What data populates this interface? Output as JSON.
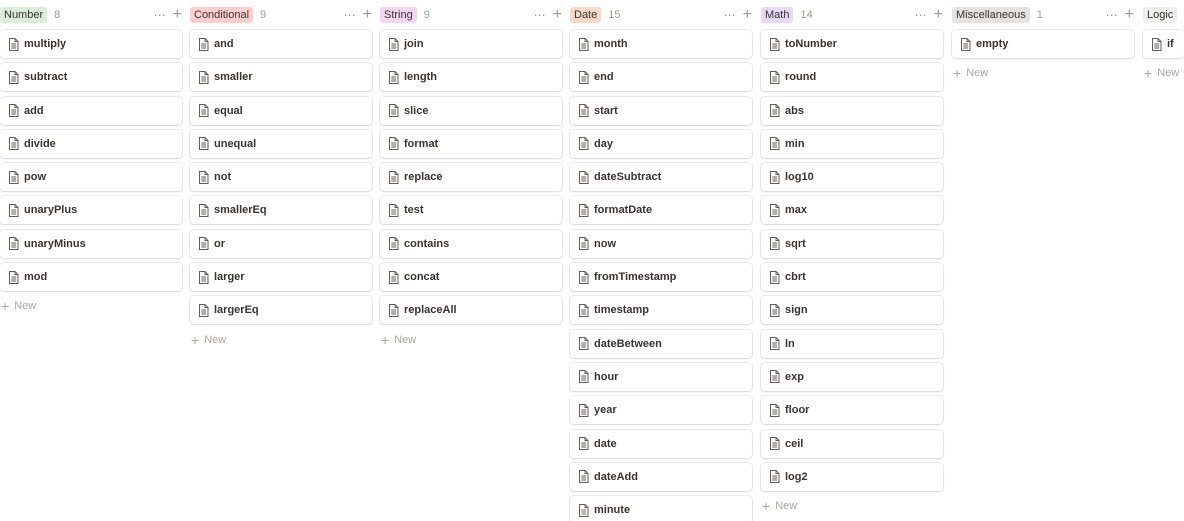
{
  "board": {
    "new_label": "New",
    "columns": [
      {
        "title": "Number",
        "count": "8",
        "tag_color": "#dbeddb",
        "items": [
          "multiply",
          "subtract",
          "add",
          "divide",
          "pow",
          "unaryPlus",
          "unaryMinus",
          "mod"
        ],
        "new_label": "New"
      },
      {
        "title": "Conditional",
        "count": "9",
        "tag_color": "#ffcfcf",
        "items": [
          "and",
          "smaller",
          "equal",
          "unequal",
          "not",
          "smallerEq",
          "or",
          "larger",
          "largerEq"
        ],
        "new_label": "New"
      },
      {
        "title": "String",
        "count": "9",
        "tag_color": "#f5d6f0",
        "items": [
          "join",
          "length",
          "slice",
          "format",
          "replace",
          "test",
          "contains",
          "concat",
          "replaceAll"
        ],
        "new_label": "New"
      },
      {
        "title": "Date",
        "count": "15",
        "tag_color": "#f8d9c8",
        "items": [
          "month",
          "end",
          "start",
          "day",
          "dateSubtract",
          "formatDate",
          "now",
          "fromTimestamp",
          "timestamp",
          "dateBetween",
          "hour",
          "year",
          "date",
          "dateAdd",
          "minute"
        ],
        "new_label": ""
      },
      {
        "title": "Math",
        "count": "14",
        "tag_color": "#e4d9f7",
        "items": [
          "toNumber",
          "round",
          "abs",
          "min",
          "log10",
          "max",
          "sqrt",
          "cbrt",
          "sign",
          "ln",
          "exp",
          "floor",
          "ceil",
          "log2"
        ],
        "new_label": "New"
      },
      {
        "title": "Miscellaneous",
        "count": "1",
        "tag_color": "#e3e2e0",
        "items": [
          "empty"
        ],
        "new_label": "New"
      },
      {
        "title": "Logic",
        "count": "",
        "tag_color": "#eeeeed",
        "items": [
          "if"
        ],
        "new_label": "New"
      }
    ]
  },
  "icons": {
    "card_icon": "page-icon",
    "more": "ellipsis-icon",
    "add": "plus-icon"
  }
}
